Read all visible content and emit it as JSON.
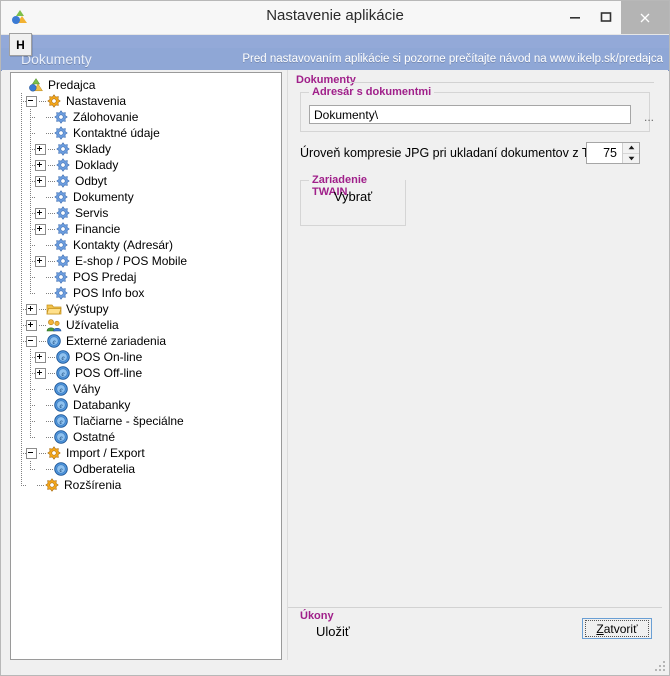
{
  "window": {
    "title": "Nastavenie aplikácie",
    "app_icon": "app-logo-icon",
    "minimize_label": "–",
    "maximize_label": "□",
    "close_label": "×"
  },
  "menubar": {
    "items": [
      {
        "label": "H",
        "name": "menu-h"
      }
    ]
  },
  "banner": {
    "section": "Dokumenty",
    "notice": "Pred nastavovaním aplikácie si pozorne prečítajte návod na www.ikelp.sk/predajca",
    "bg_color": "#8fa7d6"
  },
  "tree": {
    "nodes": [
      {
        "label": "Predajca",
        "indent": 0,
        "toggle": "none",
        "icon": "app-logo-icon",
        "connector": "root"
      },
      {
        "label": "Nastavenia",
        "indent": 1,
        "toggle": "minus",
        "icon": "gear-orange-icon",
        "connector": "tee"
      },
      {
        "label": "Zálohovanie",
        "indent": 2,
        "toggle": "none",
        "icon": "gear-blue-icon",
        "connector": "tee"
      },
      {
        "label": "Kontaktné údaje",
        "indent": 2,
        "toggle": "none",
        "icon": "gear-blue-icon",
        "connector": "tee"
      },
      {
        "label": "Sklady",
        "indent": 2,
        "toggle": "plus",
        "icon": "gear-blue-icon",
        "connector": "tee"
      },
      {
        "label": "Doklady",
        "indent": 2,
        "toggle": "plus",
        "icon": "gear-blue-icon",
        "connector": "tee"
      },
      {
        "label": "Odbyt",
        "indent": 2,
        "toggle": "plus",
        "icon": "gear-blue-icon",
        "connector": "tee"
      },
      {
        "label": "Dokumenty",
        "indent": 2,
        "toggle": "none",
        "icon": "gear-blue-icon",
        "connector": "tee"
      },
      {
        "label": "Servis",
        "indent": 2,
        "toggle": "plus",
        "icon": "gear-blue-icon",
        "connector": "tee"
      },
      {
        "label": "Financie",
        "indent": 2,
        "toggle": "plus",
        "icon": "gear-blue-icon",
        "connector": "tee"
      },
      {
        "label": "Kontakty (Adresár)",
        "indent": 2,
        "toggle": "none",
        "icon": "gear-blue-icon",
        "connector": "tee"
      },
      {
        "label": "E-shop / POS Mobile",
        "indent": 2,
        "toggle": "plus",
        "icon": "gear-blue-icon",
        "connector": "tee"
      },
      {
        "label": "POS Predaj",
        "indent": 2,
        "toggle": "none",
        "icon": "gear-blue-icon",
        "connector": "tee"
      },
      {
        "label": "POS Info box",
        "indent": 2,
        "toggle": "none",
        "icon": "gear-blue-icon",
        "connector": "elbow"
      },
      {
        "label": "Výstupy",
        "indent": 1,
        "toggle": "plus",
        "icon": "folder-icon",
        "connector": "tee"
      },
      {
        "label": "Užívatelia",
        "indent": 1,
        "toggle": "plus",
        "icon": "users-icon",
        "connector": "tee"
      },
      {
        "label": "Externé zariadenia",
        "indent": 1,
        "toggle": "minus",
        "icon": "device-e-icon",
        "connector": "tee"
      },
      {
        "label": "POS On-line",
        "indent": 2,
        "toggle": "plus",
        "icon": "device-e-icon",
        "connector": "tee"
      },
      {
        "label": "POS Off-line",
        "indent": 2,
        "toggle": "plus",
        "icon": "device-e-icon",
        "connector": "tee"
      },
      {
        "label": "Váhy",
        "indent": 2,
        "toggle": "none",
        "icon": "device-e-icon",
        "connector": "tee"
      },
      {
        "label": "Databanky",
        "indent": 2,
        "toggle": "none",
        "icon": "device-e-icon",
        "connector": "tee"
      },
      {
        "label": "Tlačiarne - špeciálne",
        "indent": 2,
        "toggle": "none",
        "icon": "device-e-icon",
        "connector": "tee"
      },
      {
        "label": "Ostatné",
        "indent": 2,
        "toggle": "none",
        "icon": "device-e-icon",
        "connector": "elbow"
      },
      {
        "label": "Import / Export",
        "indent": 1,
        "toggle": "minus",
        "icon": "gear-orange-icon",
        "connector": "tee"
      },
      {
        "label": "Odberatelia",
        "indent": 2,
        "toggle": "none",
        "icon": "device-e-icon",
        "connector": "elbow"
      },
      {
        "label": "Rozšírenia",
        "indent": 1,
        "toggle": "none",
        "icon": "gear-orange-icon",
        "connector": "elbow"
      }
    ]
  },
  "panel": {
    "section_title": "Dokumenty",
    "directory_group": {
      "label": "Adresár s dokumentmi",
      "path_value": "Dokumenty\\",
      "path_placeholder": "",
      "browse_label": "..."
    },
    "jpg": {
      "label": "Úroveň kompresie JPG pri ukladaní dokumentov z TWAIN",
      "value": "75",
      "spin_up": "▲",
      "spin_down": "▼"
    },
    "twain_group": {
      "label": "Zariadenie TWAIN",
      "button_label": "Vybrať"
    },
    "actions": {
      "label": "Úkony",
      "save_label": "Uložiť",
      "close_accel": "Z",
      "close_rest": "atvoriť"
    }
  },
  "colors": {
    "group_label": "#a0208a",
    "banner": "#8fa7d6",
    "window_bg": "#f0f0f0",
    "tree_bg": "#ffffff",
    "focus_border": "#6a9fd4"
  }
}
